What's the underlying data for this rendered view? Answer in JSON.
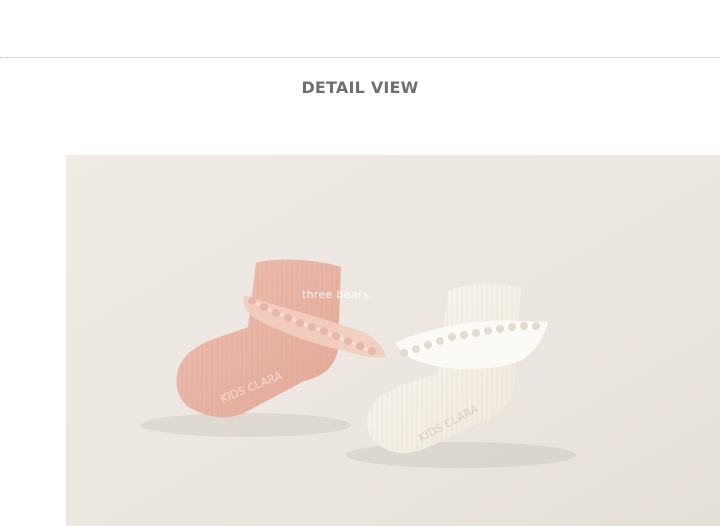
{
  "section": {
    "title": "DETAIL VIEW"
  },
  "photo": {
    "watermark": "three bears.",
    "pink_sock": {
      "sole_print": "KIDS CLARA",
      "color": "#e9b6a7"
    },
    "white_sock": {
      "sole_print": "KIDS CLARA",
      "color": "#f7f2ea"
    },
    "background_color": "#ece8e1"
  }
}
